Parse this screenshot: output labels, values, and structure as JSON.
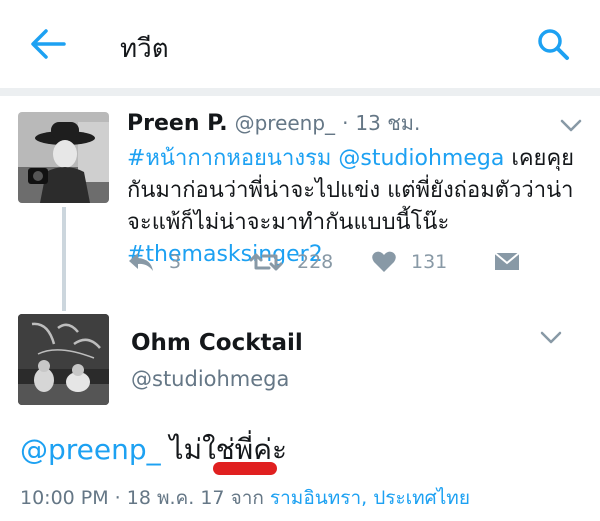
{
  "topbar": {
    "title": "ทวีต",
    "back_icon": "arrow-left-icon",
    "search_icon": "search-icon",
    "accent": "#1da1f2"
  },
  "tweet1": {
    "name": "Preen P.",
    "handle": "@preenp_",
    "dot": "·",
    "time": "13 ชม.",
    "body": {
      "hashtag1": "#หน้ากากหอยนางรม",
      "space1": " ",
      "mention1": "@studiohmega",
      "text1": " เคยคุยกันมาก่อนว่าพี่น่าจะไปแข่ง แต่พี่ยังถ่อมตัวว่าน่าจะแพ้ก็ไม่น่าจะมาทำกันแบบนี้โน๊ะ ",
      "hashtag2": "#themasksinger2"
    },
    "actions": {
      "reply_count": "3",
      "retweet_count": "228",
      "like_count": "131"
    }
  },
  "tweet2": {
    "name": "Ohm Cocktail",
    "handle": "@studiohmega",
    "body": {
      "mention": "@preenp_",
      "text": " ไม่ใช่พี่ค่ะ"
    },
    "meta": {
      "time_date": "10:00 PM · 18 พ.ค. 17 ",
      "from": "จาก ",
      "location": "รามอินทรา, ประเทศไทย"
    }
  },
  "colors": {
    "text": "#14171a",
    "muted": "#657786",
    "icon_gray": "#8899a6",
    "link": "#1da1f2",
    "annotation_red": "#e02020"
  }
}
